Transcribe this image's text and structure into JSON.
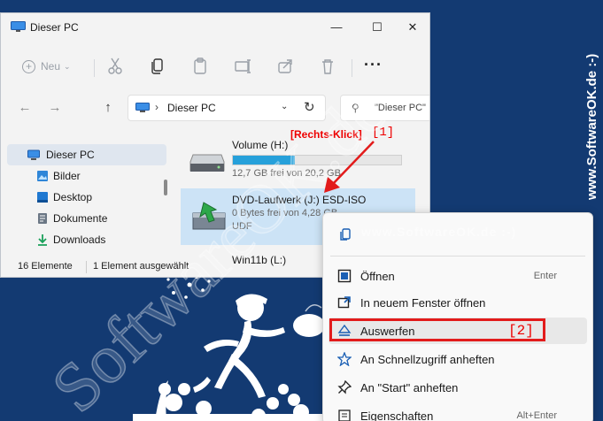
{
  "window": {
    "title": "Dieser PC"
  },
  "window_controls": {
    "minimize": "—",
    "maximize": "☐",
    "close": "✕"
  },
  "toolbar": {
    "new_label": "Neu",
    "more": "···"
  },
  "nav": {
    "back": "←",
    "forward": "→",
    "up": "↑"
  },
  "address": {
    "path": "Dieser PC",
    "separator": "›",
    "dropdown": "⌄",
    "refresh": "↻"
  },
  "search": {
    "placeholder": "\"Dieser PC\""
  },
  "sidebar": {
    "items": [
      {
        "label": "Dieser PC",
        "icon": "pc-icon"
      },
      {
        "label": "Bilder",
        "icon": "pictures-icon"
      },
      {
        "label": "Desktop",
        "icon": "desktop-icon"
      },
      {
        "label": "Dokumente",
        "icon": "documents-icon"
      },
      {
        "label": "Downloads",
        "icon": "downloads-icon"
      }
    ]
  },
  "drives": [
    {
      "name": "Volume (H:)",
      "space": "12,7 GB frei von 20,2 GB",
      "used_fraction": 0.37
    },
    {
      "name": "DVD-Laufwerk (J:) ESD-ISO",
      "space": "0 Bytes frei von 4,28 GB",
      "fs": "UDF"
    },
    {
      "name": "Win11b (L:)"
    }
  ],
  "status": {
    "count": "16 Elemente",
    "selected": "1 Element ausgewählt"
  },
  "annotations": {
    "right_click": "[Rechts-Klick]",
    "step1": "[1]",
    "step2": "[2]"
  },
  "context_menu": {
    "items": [
      {
        "label": "Öffnen",
        "shortcut": "Enter",
        "icon": "open-icon"
      },
      {
        "label": "In neuem Fenster öffnen",
        "shortcut": "",
        "icon": "new-window-icon"
      },
      {
        "label": "Auswerfen",
        "shortcut": "",
        "icon": "eject-icon"
      },
      {
        "label": "An Schnellzugriff anheften",
        "shortcut": "",
        "icon": "star-pin-icon"
      },
      {
        "label": "An \"Start\" anheften",
        "shortcut": "",
        "icon": "pin-icon"
      },
      {
        "label": "Eigenschaften",
        "shortcut": "Alt+Enter",
        "icon": "properties-icon"
      }
    ]
  },
  "watermark": {
    "text": "www.SoftwareOK.de :-)",
    "diag_text": "SoftwareOK.de",
    "inline_text": "www.SoftwareOK.de :-)"
  },
  "colors": {
    "background": "#133a72",
    "accent": "#26a0da",
    "annotation": "#e21b1b",
    "selection": "#cce3f6"
  }
}
